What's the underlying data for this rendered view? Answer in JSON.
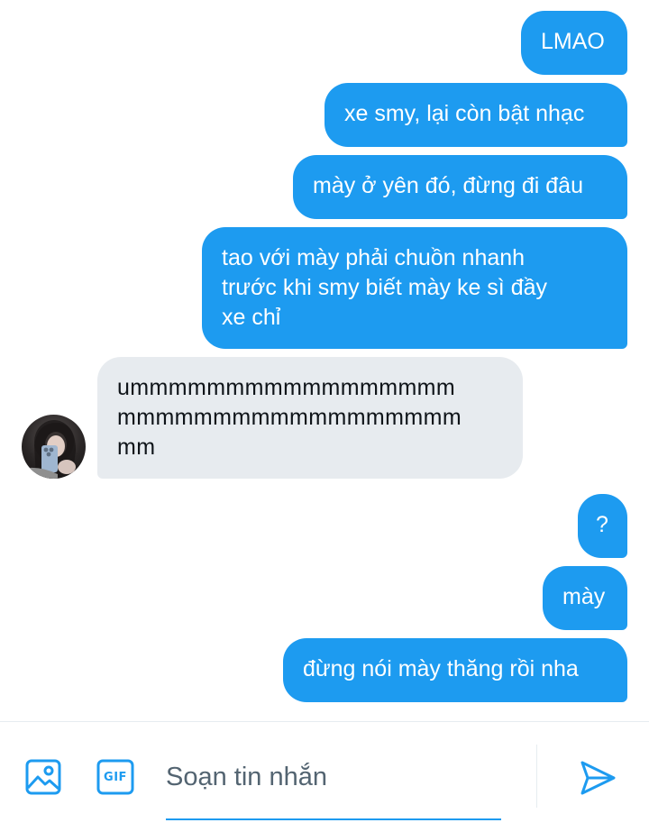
{
  "messages": [
    {
      "text": "LMAO",
      "sender": "me"
    },
    {
      "text": "xe smy, lại còn bật nhạc",
      "sender": "me"
    },
    {
      "text": "mày ở yên đó, đừng đi đâu",
      "sender": "me"
    },
    {
      "text": "tao với mày phải chuồn nhanh\ntrước khi smy biết mày ke sì đầy\nxe chỉ",
      "sender": "me"
    },
    {
      "text": "ummmmmmmmmmmmmmmmm\nmmmmmmmmmmmmmmmmmm\nmm",
      "sender": "other"
    },
    {
      "text": "?",
      "sender": "me"
    },
    {
      "text": "mày",
      "sender": "me"
    },
    {
      "text": "đừng nói mày thăng rồi nha",
      "sender": "me"
    }
  ],
  "composer": {
    "placeholder": "Soạn tin nhắn",
    "image_icon": "image-icon",
    "gif_label": "GIF",
    "send_icon": "send-icon"
  },
  "colors": {
    "accent": "#1d9bf0",
    "received_bubble": "#e7ebef",
    "text": "#0f1419"
  }
}
